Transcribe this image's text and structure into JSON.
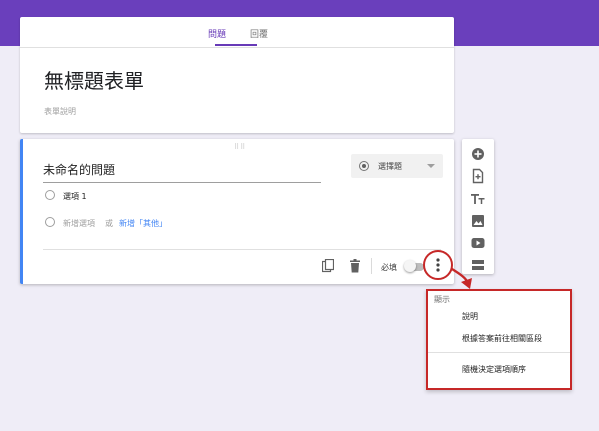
{
  "tabs": {
    "questions_label": "問題",
    "responses_label": "回覆"
  },
  "form": {
    "title": "無標題表單",
    "description_placeholder": "表單說明"
  },
  "question": {
    "title": "未命名的問題",
    "type_label": "選擇題",
    "option_1": "選項 1",
    "add_option": "新增選項",
    "or_text": "或",
    "add_other": "新增「其他」",
    "required_label": "必填"
  },
  "menu": {
    "header": "顯示",
    "items": [
      "說明",
      "根據答案前往相關區段",
      "隨機決定選項順序"
    ]
  },
  "colors": {
    "accent": "#673ab7",
    "band": "#6a3fbc",
    "question_border": "#4285f4",
    "highlight": "#c62828"
  },
  "icons": {
    "toolbar": [
      "add-question-icon",
      "import-questions-icon",
      "add-title-icon",
      "add-image-icon",
      "add-video-icon",
      "add-section-icon"
    ],
    "footer": [
      "duplicate-icon",
      "delete-icon",
      "more-vert-icon"
    ]
  }
}
